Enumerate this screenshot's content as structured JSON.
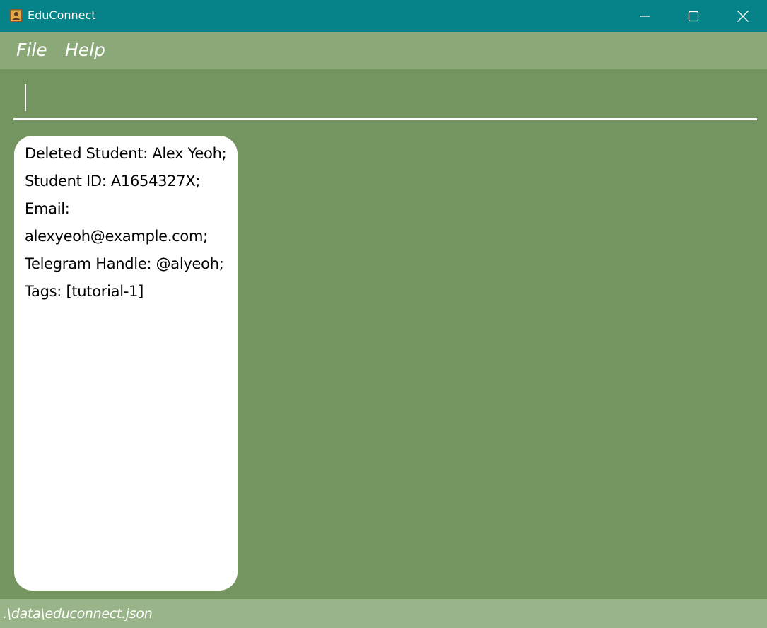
{
  "window": {
    "title": "EduConnect",
    "icon": "contacts-book-icon",
    "controls": {
      "minimize": "minimize-icon",
      "maximize": "maximize-icon",
      "close": "close-icon"
    }
  },
  "menu": {
    "items": [
      {
        "label": "File"
      },
      {
        "label": "Help"
      }
    ]
  },
  "command_box": {
    "value": "",
    "placeholder": ""
  },
  "result_display": {
    "text": "Deleted Student: Alex Yeoh; Student ID: A1654327X; Email: alexyeoh@example.com; Telegram Handle: @alyeoh; Tags: [tutorial-1]"
  },
  "status_bar": {
    "file_path": ".\\data\\educonnect.json"
  },
  "colors": {
    "title_bar": "#058388",
    "menu_bar": "#8ba879",
    "background": "#74955f",
    "status_bar": "#99b489",
    "result_box": "#ffffff"
  }
}
